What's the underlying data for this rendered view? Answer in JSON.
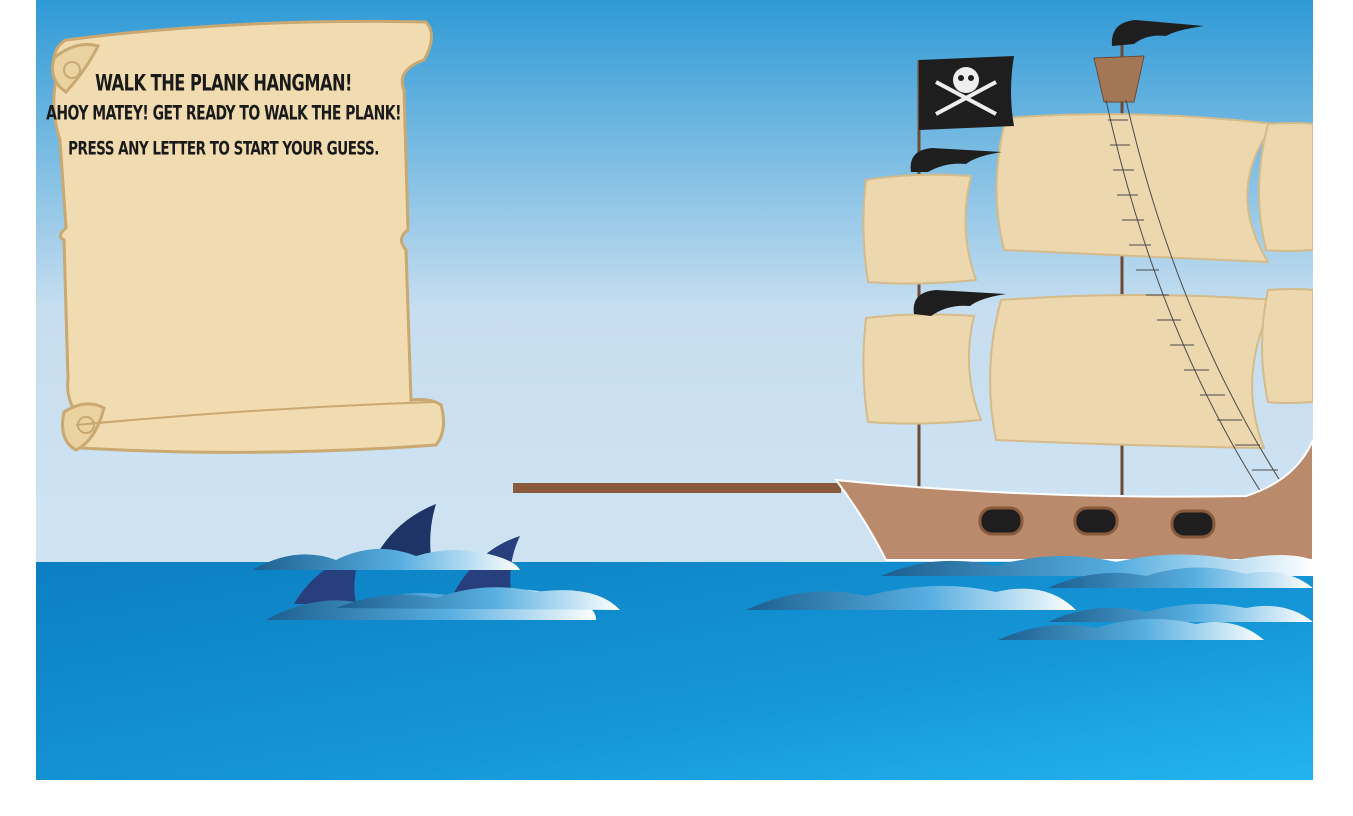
{
  "game": {
    "title": "Walk the Plank Hangman!",
    "subtitle": "Ahoy Matey! Get ready to walk the plank!",
    "instruction": "Press any letter to start your guess."
  },
  "colors": {
    "sky_top": "#2f9ad6",
    "sky_bottom": "#c7def0",
    "sea_top": "#0f8fd0",
    "sea_bottom": "#1ea9e6",
    "parchment": "#f0dcb0",
    "parchment_edge": "#c9a871",
    "sail": "#ecd7ae",
    "hull": "#b98a6b",
    "flag": "#1e1e1e",
    "fin": "#233a73",
    "plank": "#8a5a3c"
  },
  "icons": [
    "jolly-roger-flag-icon",
    "shark-fin-icon",
    "wave-icon",
    "porthole-icon",
    "rope-ladder-icon"
  ]
}
